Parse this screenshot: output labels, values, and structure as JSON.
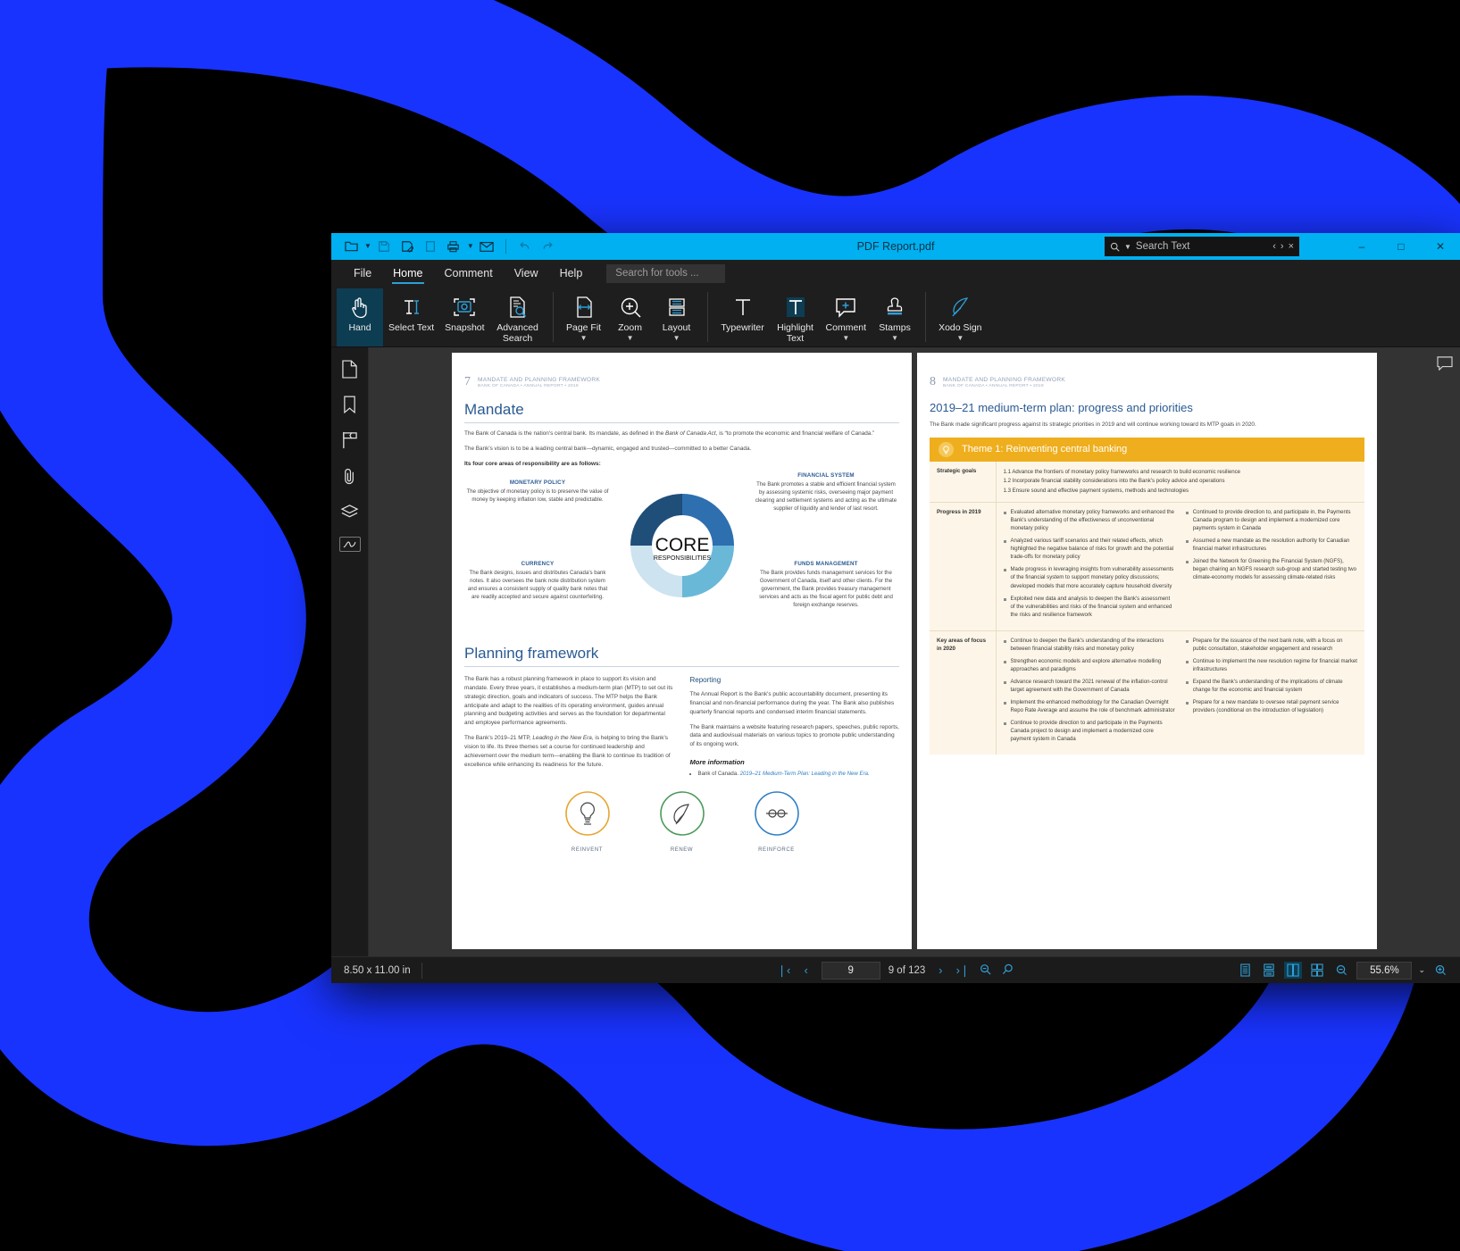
{
  "window": {
    "title": "PDF Report.pdf",
    "quick_access": [
      "open-folder-icon",
      "save-icon",
      "save-as-icon",
      "print-preview-icon",
      "print-icon",
      "email-icon",
      "undo-icon",
      "redo-icon"
    ],
    "search": {
      "placeholder": "Search Text",
      "prev": "‹",
      "next": "›",
      "clear": "×"
    },
    "controls": {
      "minimize": "–",
      "maximize": "□",
      "close": "✕"
    }
  },
  "menubar": {
    "items": [
      "File",
      "Home",
      "Comment",
      "View",
      "Help"
    ],
    "active": "Home",
    "tool_search_placeholder": "Search for tools ..."
  },
  "ribbon": {
    "groups": [
      {
        "items": [
          {
            "label": "Hand",
            "icon": "hand-icon",
            "selected": true,
            "dropdown": false
          },
          {
            "label": "Select Text",
            "icon": "select-text-icon",
            "selected": false,
            "dropdown": false
          },
          {
            "label": "Snapshot",
            "icon": "snapshot-icon",
            "selected": false,
            "dropdown": false
          },
          {
            "label": "Advanced Search",
            "icon": "advanced-search-icon",
            "selected": false,
            "dropdown": false
          }
        ]
      },
      {
        "items": [
          {
            "label": "Page Fit",
            "icon": "page-fit-icon",
            "selected": false,
            "dropdown": true
          },
          {
            "label": "Zoom",
            "icon": "zoom-in-icon",
            "selected": false,
            "dropdown": true
          },
          {
            "label": "Layout",
            "icon": "layout-icon",
            "selected": false,
            "dropdown": true
          }
        ]
      },
      {
        "items": [
          {
            "label": "Typewriter",
            "icon": "typewriter-icon",
            "selected": false,
            "dropdown": false
          },
          {
            "label": "Highlight Text",
            "icon": "highlight-text-icon",
            "selected": false,
            "dropdown": false
          },
          {
            "label": "Comment",
            "icon": "comment-add-icon",
            "selected": false,
            "dropdown": true
          },
          {
            "label": "Stamps",
            "icon": "stamp-icon",
            "selected": false,
            "dropdown": true
          }
        ]
      },
      {
        "items": [
          {
            "label": "Xodo Sign",
            "icon": "feather-pen-icon",
            "selected": false,
            "dropdown": true
          }
        ]
      }
    ]
  },
  "sidebar": {
    "items": [
      {
        "name": "thumbnails-panel",
        "icon": "page-icon"
      },
      {
        "name": "bookmarks-panel",
        "icon": "bookmark-icon"
      },
      {
        "name": "annotations-panel",
        "icon": "flag-icon"
      },
      {
        "name": "attachments-panel",
        "icon": "paperclip-icon"
      },
      {
        "name": "layers-panel",
        "icon": "layers-icon"
      },
      {
        "name": "signatures-panel",
        "icon": "signature-icon"
      }
    ]
  },
  "statusbar": {
    "page_dimensions": "8.50 x 11.00 in",
    "first_page": "❘‹",
    "prev_page": "‹",
    "page_value": "9",
    "page_of": "9 of 123",
    "next_page": "›",
    "last_page": "›❘",
    "zoom_out_tool": "zoom-out-icon",
    "pan_tool": "zoom-pan-icon",
    "view_modes": [
      "single-page-icon",
      "continuous-icon",
      "facing-pages-icon",
      "facing-continuous-icon"
    ],
    "active_view_mode": 2,
    "zoom_minus": "⊖",
    "zoom_value": "55.6%",
    "zoom_dropdown": "⌄",
    "zoom_plus": "zoom-in-small-icon"
  },
  "pdf": {
    "left_page": {
      "page_number": "7",
      "header_line1": "MANDATE AND PLANNING FRAMEWORK",
      "header_line2": "BANK OF CANADA • ANNUAL REPORT • 2019",
      "h1": "Mandate",
      "p1_a": "The Bank of Canada is the nation's central bank. Its mandate, as defined in the ",
      "p1_italic": "Bank of Canada Act",
      "p1_b": ", is “to promote the economic and financial welfare of Canada.”",
      "p2": "The Bank's vision is to be a leading central bank—dynamic, engaged and trusted—committed to a better Canada.",
      "p3": "Its four core areas of responsibility are as follows:",
      "donut": {
        "center_big": "CORE",
        "center_small": "RESPONSIBILITIES",
        "segments": [
          {
            "label": "FINANCIAL SYSTEM",
            "color": "#2e6fb0"
          },
          {
            "label": "FUNDS MANAGEMENT",
            "color": "#6ab8d8"
          },
          {
            "label": "CURRENCY",
            "color": "#cde3ef"
          },
          {
            "label": "MONETARY POLICY",
            "color": "#1f4e79"
          }
        ]
      },
      "quadrants": [
        {
          "title": "MONETARY POLICY",
          "text": "The objective of monetary policy is to preserve the value of money by keeping inflation low, stable and predictable."
        },
        {
          "title": "FINANCIAL SYSTEM",
          "text": "The Bank promotes a stable and efficient financial system by assessing systemic risks, overseeing major payment clearing and settlement systems and acting as the ultimate supplier of liquidity and lender of  last resort."
        },
        {
          "title": "CURRENCY",
          "text": "The Bank designs, issues and distributes Canada's bank notes. It also oversees the bank note distribution system and ensures a consistent supply of quality bank notes that are readily accepted and secure against counterfeiting."
        },
        {
          "title": "FUNDS MANAGEMENT",
          "text": "The Bank provides funds management services for the Government of Canada, itself and other clients. For the government, the Bank provides treasury management services and acts as the fiscal agent for public debt and foreign exchange reserves."
        }
      ],
      "h2": "Planning framework",
      "left_col_p1": "The Bank has a robust planning framework in place to support its vision and mandate. Every three years, it establishes a medium-term plan (MTP) to set out its strategic direction, goals and indicators of success. The MTP helps the Bank anticipate and adapt to the realities of its operating environment, guides annual planning and budgeting activities and serves as the foundation for departmental and employee performance agreements.",
      "left_col_p2_a": "The Bank's 2019–21 MTP, ",
      "left_col_p2_italic": "Leading in the New Era",
      "left_col_p2_b": ", is helping to bring the Bank's vision to life. Its three themes set a course for continued leadership and achievement over the medium term—enabling the Bank to continue its tradition of excellence while enhancing its readiness for the future.",
      "right_col_h": "Reporting",
      "right_col_p1": "The Annual Report is the Bank's public accountability document, presenting its financial and non-financial performance during the year. The Bank also publishes quarterly financial reports and condensed interim financial statements.",
      "right_col_p2": "The Bank maintains a website featuring research papers, speeches, public reports, data and audiovisual materials on various topics to promote public understanding of its ongoing work.",
      "more_info_h": "More information",
      "more_info_item_a": "Bank of Canada. ",
      "more_info_item_link": "2019–21 Medium-Term Plan: Leading in the New Era.",
      "three_themes": [
        {
          "caption": "REINVENT",
          "icon": "lightbulb-icon",
          "color": "#e8a531"
        },
        {
          "caption": "RENEW",
          "icon": "leaf-icon",
          "color": "#4c9a5a"
        },
        {
          "caption": "REINFORCE",
          "icon": "link-icon",
          "color": "#2f7fc4"
        }
      ]
    },
    "right_page": {
      "page_number": "8",
      "header_line1": "MANDATE AND PLANNING FRAMEWORK",
      "header_line2": "BANK OF CANADA • ANNUAL REPORT • 2019",
      "h1": "2019–21 medium-term plan: progress and priorities",
      "intro": "The Bank made significant progress against its strategic priorities in 2019 and will continue working toward its MTP goals in 2020.",
      "theme_bar": {
        "icon": "lightbulb-circle-icon",
        "label": "Theme 1: Reinventing central banking",
        "color": "#efae1d"
      },
      "rows": [
        {
          "header": "Strategic goals",
          "goals": [
            "1.1 Advance the frontiers of monetary policy frameworks and research to build economic resilience",
            "1.2 Incorporate financial stability considerations into the Bank's policy advice and operations",
            "1.3 Ensure sound and effective payment systems, methods and technologies"
          ]
        },
        {
          "header": "Progress in 2019",
          "col1": [
            "Evaluated alternative monetary policy frameworks and enhanced the Bank's understanding of the effectiveness of unconventional monetary policy",
            "Analyzed various tariff scenarios and their related effects, which highlighted the negative balance of risks for growth and the potential trade-offs for monetary policy",
            "Made progress in leveraging insights from vulnerability assessments of the financial system to support monetary policy discussions; developed models that more accurately capture household diversity",
            "Exploited new data and analysis to deepen the Bank's assessment of the vulnerabilities and risks of the financial system and enhanced the risks and resilience framework"
          ],
          "col2": [
            "Continued to provide direction to, and participate in, the Payments Canada program to design and implement a modernized core payments system in Canada",
            "Assumed a new mandate as the resolution authority for Canadian financial market infrastructures",
            "Joined the Network for Greening the Financial System (NGFS), began chairing an NGFS research sub-group and started testing two climate-economy models for assessing climate-related risks"
          ]
        },
        {
          "header": "Key areas of focus in 2020",
          "col1": [
            "Continue to deepen the Bank's understanding of the interactions between financial stability risks and monetary policy",
            "Strengthen economic models and explore alternative modelling approaches and paradigms",
            "Advance research toward the 2021 renewal of the inflation-control target agreement with the Government of Canada",
            "Implement the enhanced methodology for the Canadian Overnight Repo Rate Average and assume the role of benchmark administrator",
            "Continue to provide direction to and participate in the Payments Canada project to design and implement a modernized core payment system in Canada"
          ],
          "col2": [
            "Prepare for the issuance of the next bank note, with a focus on public consultation, stakeholder engagement and research",
            "Continue to implement the new resolution regime for financial market infrastructures",
            "Expand the Bank's understanding of the implications of climate change for the economic and financial system",
            "Prepare for a new mandate to oversee retail payment service providers (conditional on the introduction of legislation)"
          ]
        }
      ]
    }
  },
  "colors": {
    "titlebar": "#00b0f0",
    "accent_blue": "#2d9fd9",
    "ribbon_bg": "#1e1e1e",
    "selected_tool": "#0d3d52",
    "theme_gold": "#efae1d",
    "bg_blue": "#1933ff"
  }
}
